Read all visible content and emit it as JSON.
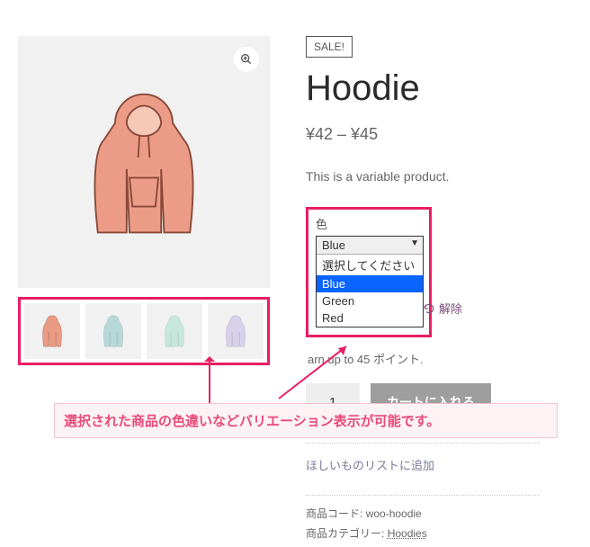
{
  "sale_badge": "SALE!",
  "title": "Hoodie",
  "price": "¥42 – ¥45",
  "description": "This is a variable product.",
  "color": {
    "label": "色",
    "selected": "Blue",
    "options": [
      "選択してください",
      "Blue",
      "Green",
      "Red"
    ]
  },
  "reset_label": "解除",
  "points_text": "arn up to 45 ポイント.",
  "quantity_value": "1",
  "add_to_cart_label": "カートに入れる",
  "wishlist_label": "ほしいものリストに追加",
  "meta": {
    "sku_label": "商品コード:",
    "sku_value": "woo-hoodie",
    "cat_label": "商品カテゴリー:",
    "cat_value": "Hoodies"
  },
  "caption": "選択された商品の色違いなどバリエーション表示が可能です。",
  "thumb_colors": [
    "#e99a83",
    "#b8d8d8",
    "#c9e6dd",
    "#d6d0e8"
  ]
}
